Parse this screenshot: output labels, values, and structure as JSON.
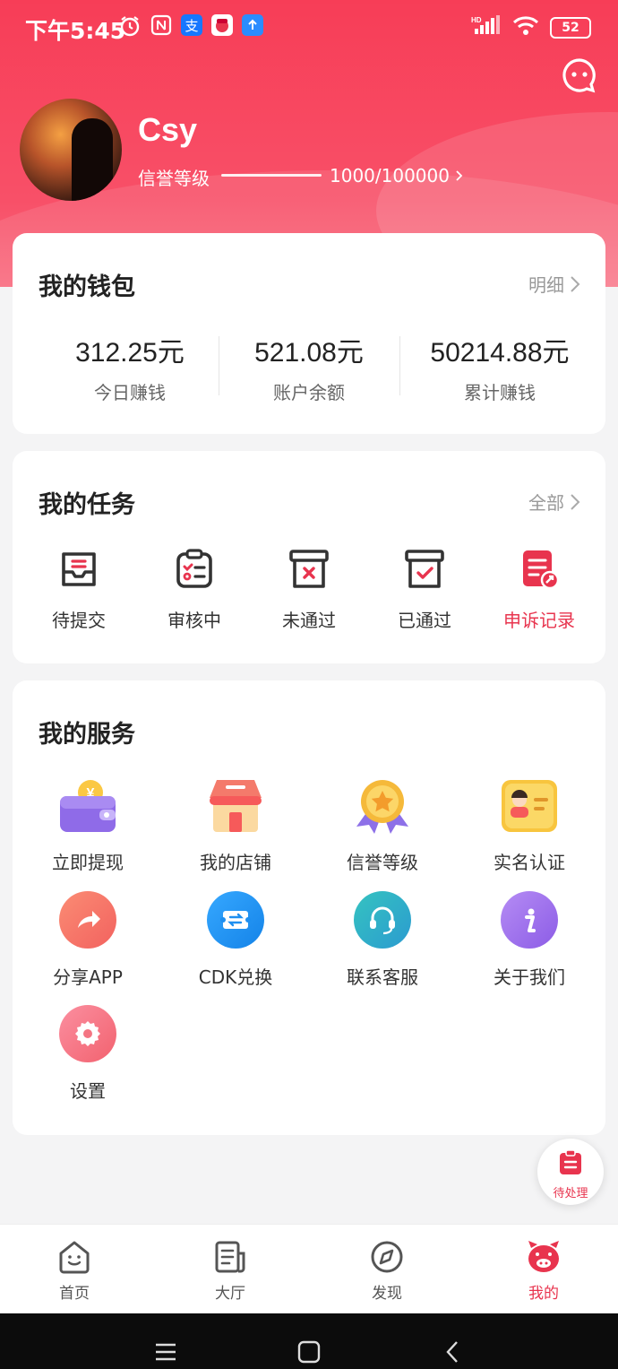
{
  "status": {
    "time": "下午5:45",
    "battery": "52"
  },
  "profile": {
    "username": "Csy",
    "credit_label": "信誉等级",
    "credit_value": "1000/100000",
    "credit_progress": 0.01
  },
  "wallet": {
    "title": "我的钱包",
    "detail_link": "明细",
    "stats": [
      {
        "value": "312.25元",
        "label": "今日赚钱"
      },
      {
        "value": "521.08元",
        "label": "账户余额"
      },
      {
        "value": "50214.88元",
        "label": "累计赚钱"
      }
    ]
  },
  "tasks": {
    "title": "我的任务",
    "all_link": "全部",
    "items": [
      {
        "label": "待提交",
        "icon": "inbox-icon"
      },
      {
        "label": "审核中",
        "icon": "clipboard-checklist-icon"
      },
      {
        "label": "未通过",
        "icon": "box-x-icon"
      },
      {
        "label": "已通过",
        "icon": "box-check-icon"
      },
      {
        "label": "申诉记录",
        "icon": "appeal-record-icon"
      }
    ],
    "accent_color": "#e8344e"
  },
  "services": {
    "title": "我的服务",
    "items": [
      {
        "label": "立即提现",
        "icon": "wallet-icon"
      },
      {
        "label": "我的店铺",
        "icon": "shop-icon"
      },
      {
        "label": "信誉等级",
        "icon": "medal-icon"
      },
      {
        "label": "实名认证",
        "icon": "id-card-icon"
      },
      {
        "label": "分享APP",
        "icon": "share-icon"
      },
      {
        "label": "CDK兑换",
        "icon": "exchange-icon"
      },
      {
        "label": "联系客服",
        "icon": "headset-icon"
      },
      {
        "label": "关于我们",
        "icon": "info-icon"
      },
      {
        "label": "设置",
        "icon": "settings-icon"
      }
    ]
  },
  "float_button": {
    "label": "待处理"
  },
  "tabbar": {
    "items": [
      {
        "label": "首页",
        "icon": "home-face-icon"
      },
      {
        "label": "大厅",
        "icon": "hall-icon"
      },
      {
        "label": "发现",
        "icon": "compass-icon"
      },
      {
        "label": "我的",
        "icon": "pig-icon",
        "active": true
      }
    ],
    "active_color": "#e8344e"
  },
  "colors": {
    "brand": "#f73d57",
    "accent": "#e8344e"
  }
}
